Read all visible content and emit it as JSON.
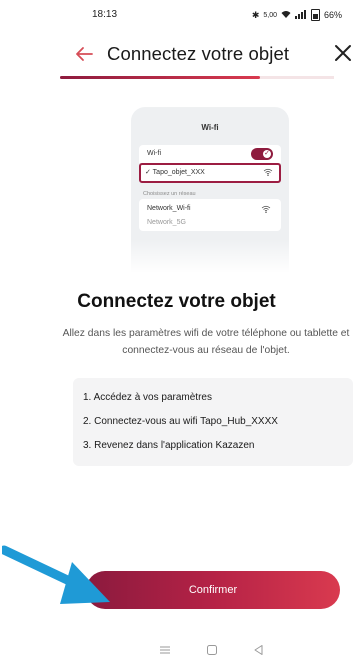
{
  "status_bar": {
    "time": "18:13",
    "network_speed": "5,00",
    "battery": "66%"
  },
  "header": {
    "title": "Connectez votre objet",
    "back_icon": "arrow-left-icon",
    "close_icon": "close-icon",
    "progress_fraction": 0.73
  },
  "illustration": {
    "screen_title": "Wi-fi",
    "wifi_label": "Wi-fi",
    "device_network": "✓ Tapo_objet_XXX",
    "choose_label": "Choisissez un réseau",
    "network_label": "Network_Wi-fi",
    "network2_label": "Network_5G"
  },
  "main": {
    "heading": "Connectez votre objet",
    "description": "Allez dans les paramètres wifi de votre téléphone ou tablette et connectez-vous au réseau de l'objet."
  },
  "steps": [
    "1. Accédez à vos paramètres",
    "2. Connectez-vous au wifi Tapo_Hub_XXXX",
    "3. Revenez dans l'application Kazazen"
  ],
  "confirm_button": {
    "label": "Confirmer"
  },
  "colors": {
    "accent": "#8e1b3e",
    "accent_light": "#d93a4f",
    "annotation": "#1f9ad6"
  }
}
